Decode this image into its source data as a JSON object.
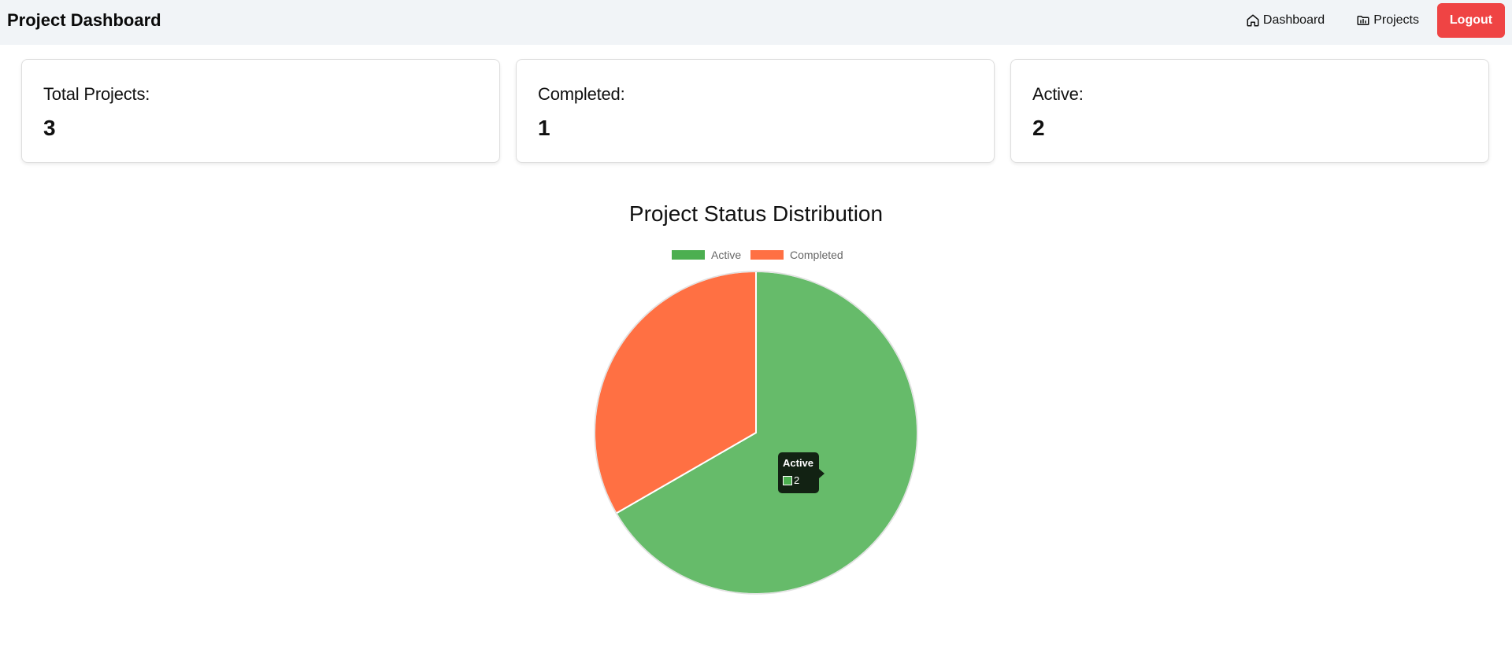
{
  "header": {
    "title": "Project Dashboard",
    "nav": [
      {
        "label": "Dashboard",
        "icon": "home-icon"
      },
      {
        "label": "Projects",
        "icon": "folder-icon"
      }
    ],
    "logout_label": "Logout",
    "logout_color": "#ef4444"
  },
  "stats": [
    {
      "label": "Total Projects:",
      "value": "3"
    },
    {
      "label": "Completed:",
      "value": "1"
    },
    {
      "label": "Active:",
      "value": "2"
    }
  ],
  "chart": {
    "title": "Project Status Distribution"
  },
  "chart_data": {
    "type": "pie",
    "title": "Project Status Distribution",
    "categories": [
      "Active",
      "Completed"
    ],
    "values": [
      2,
      1
    ],
    "colors": [
      "#66bb6a",
      "#ff7043"
    ],
    "legend_colors": [
      "#4caf50",
      "#ff7043"
    ],
    "legend_position": "top"
  },
  "tooltip": {
    "title": "Active",
    "value": "2",
    "color": "#4caf50"
  }
}
